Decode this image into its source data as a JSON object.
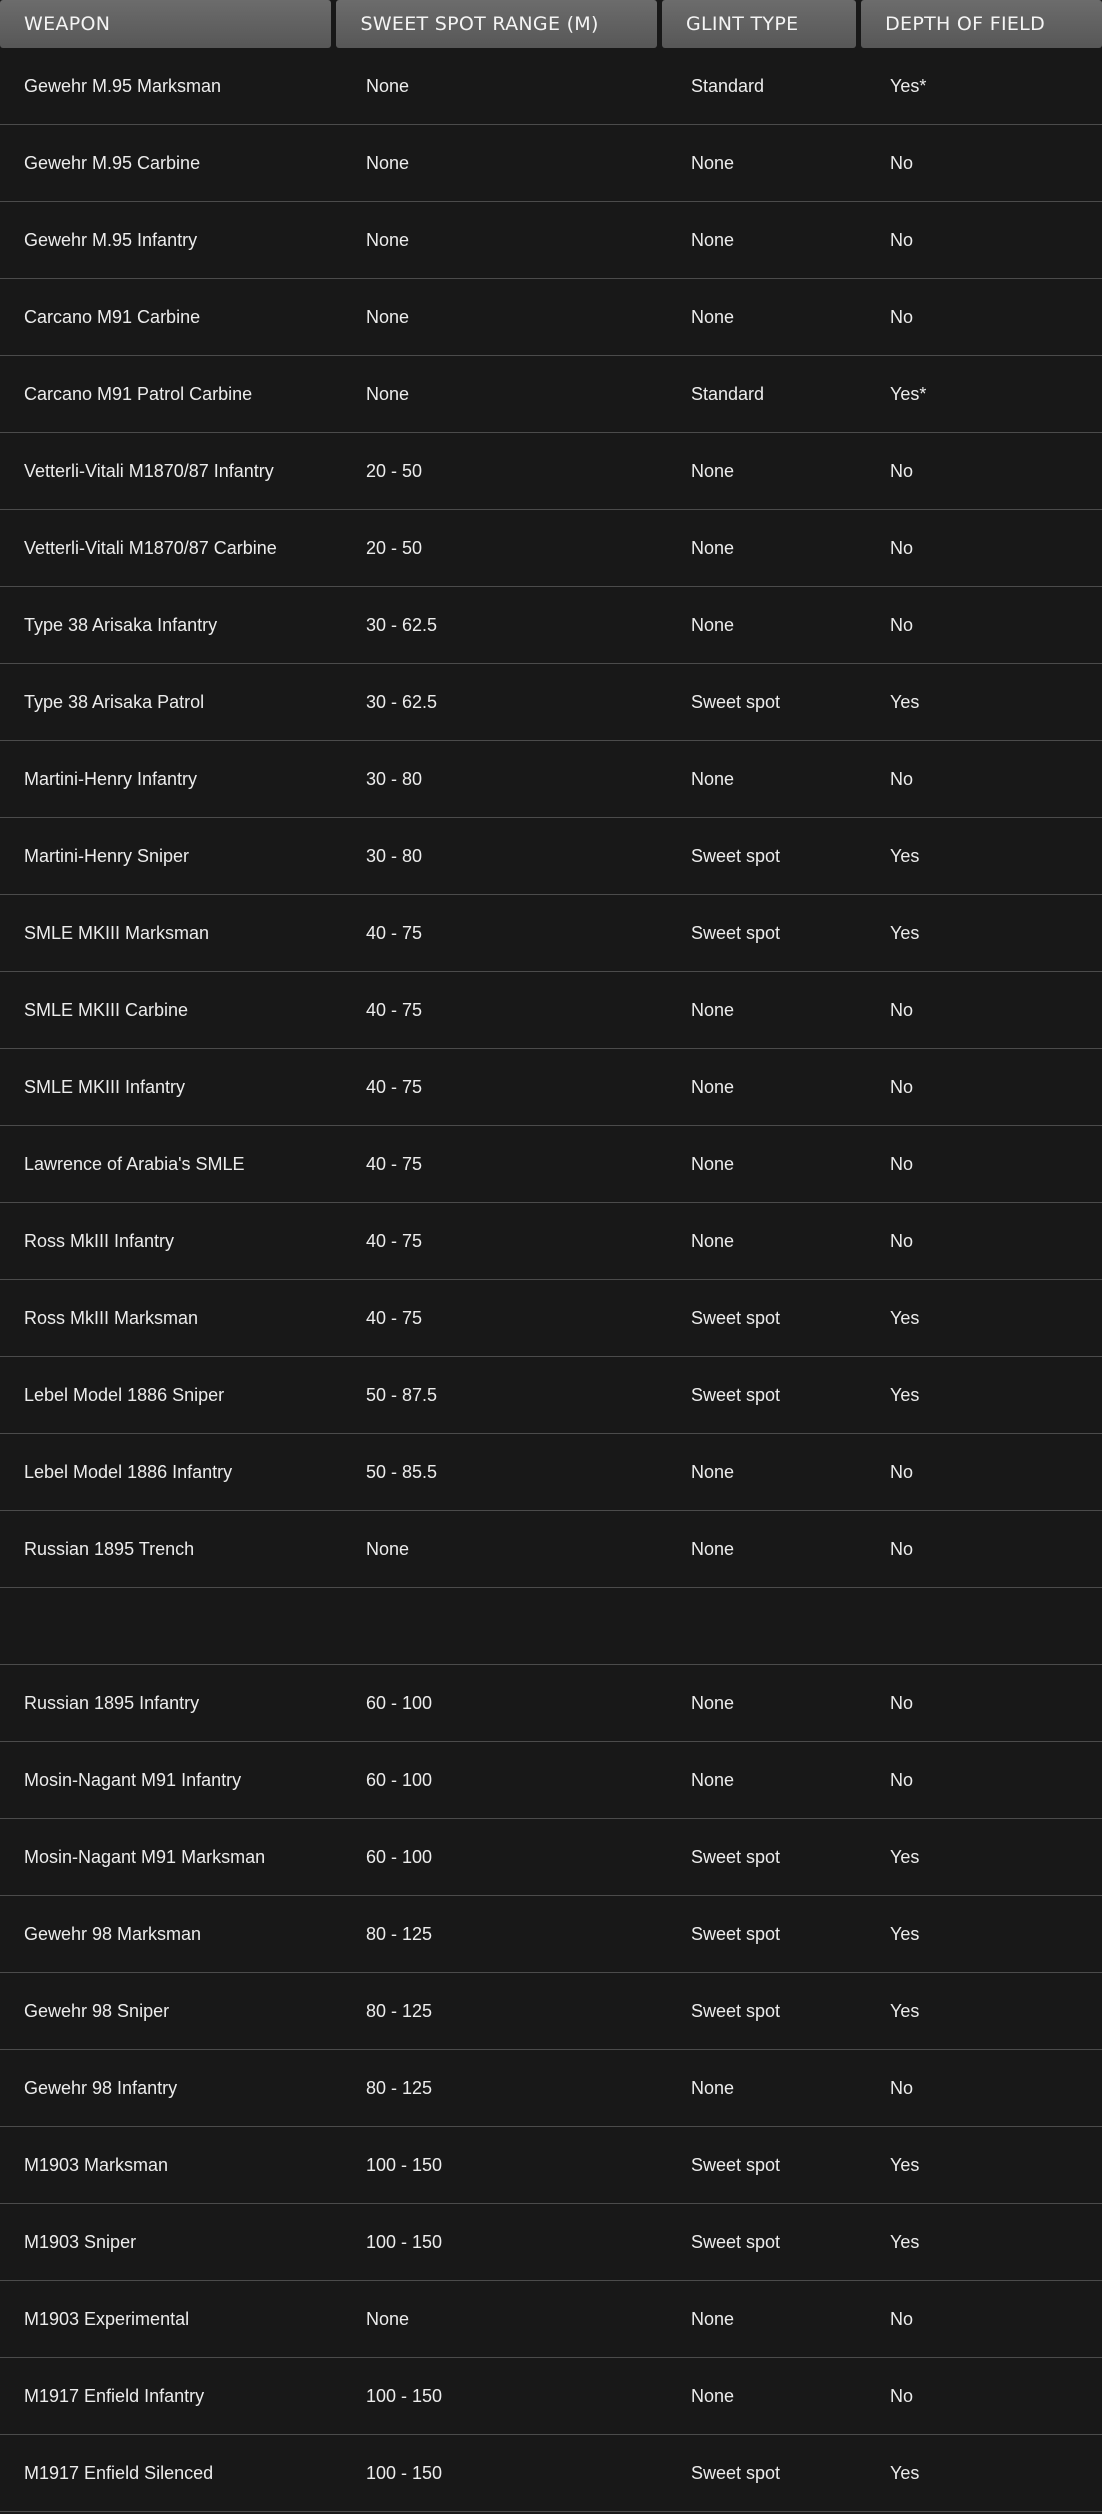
{
  "columns": [
    "WEAPON",
    "SWEET SPOT RANGE (M)",
    "GLINT TYPE",
    "DEPTH OF FIELD"
  ],
  "rows": [
    [
      "Gewehr M.95 Marksman",
      "None",
      "Standard",
      "Yes*"
    ],
    [
      "Gewehr M.95 Carbine",
      "None",
      "None",
      "No"
    ],
    [
      "Gewehr M.95 Infantry",
      "None",
      "None",
      "No"
    ],
    [
      "Carcano M91 Carbine",
      "None",
      "None",
      "No"
    ],
    [
      "Carcano M91 Patrol Carbine",
      "None",
      "Standard",
      "Yes*"
    ],
    [
      "Vetterli-Vitali M1870/87 Infantry",
      "20 - 50",
      "None",
      "No"
    ],
    [
      "Vetterli-Vitali M1870/87 Carbine",
      "20 - 50",
      "None",
      "No"
    ],
    [
      "Type 38 Arisaka Infantry",
      "30 - 62.5",
      "None",
      "No"
    ],
    [
      "Type 38 Arisaka Patrol",
      "30 - 62.5",
      "Sweet spot",
      "Yes"
    ],
    [
      "Martini-Henry Infantry",
      "30 - 80",
      "None",
      "No"
    ],
    [
      "Martini-Henry Sniper",
      "30 - 80",
      "Sweet spot",
      "Yes"
    ],
    [
      "SMLE MKIII Marksman",
      "40 - 75",
      "Sweet spot",
      "Yes"
    ],
    [
      "SMLE MKIII Carbine",
      "40 - 75",
      "None",
      "No"
    ],
    [
      "SMLE MKIII Infantry",
      "40 - 75",
      "None",
      "No"
    ],
    [
      "Lawrence of Arabia's SMLE",
      "40 - 75",
      "None",
      "No"
    ],
    [
      "Ross MkIII Infantry",
      "40 - 75",
      "None",
      "No"
    ],
    [
      "Ross MkIII Marksman",
      "40 - 75",
      "Sweet spot",
      "Yes"
    ],
    [
      "Lebel Model 1886 Sniper",
      "50 - 87.5",
      "Sweet spot",
      "Yes"
    ],
    [
      "Lebel Model 1886 Infantry",
      "50 - 85.5",
      "None",
      "No"
    ],
    [
      "Russian 1895 Trench",
      "None",
      "None",
      "No"
    ],
    [
      "",
      "",
      "",
      ""
    ],
    [
      "Russian 1895 Infantry",
      "60 - 100",
      "None",
      "No"
    ],
    [
      "Mosin-Nagant M91 Infantry",
      "60 - 100",
      "None",
      "No"
    ],
    [
      "Mosin-Nagant M91 Marksman",
      "60 - 100",
      "Sweet spot",
      "Yes"
    ],
    [
      "Gewehr 98 Marksman",
      "80 - 125",
      "Sweet spot",
      "Yes"
    ],
    [
      "Gewehr 98 Sniper",
      "80 - 125",
      "Sweet spot",
      "Yes"
    ],
    [
      "Gewehr 98 Infantry",
      "80 - 125",
      "None",
      "No"
    ],
    [
      "M1903 Marksman",
      "100 - 150",
      "Sweet spot",
      "Yes"
    ],
    [
      "M1903 Sniper",
      "100 - 150",
      "Sweet spot",
      "Yes"
    ],
    [
      "M1903 Experimental",
      "None",
      "None",
      "No"
    ],
    [
      "M1917 Enfield Infantry",
      "100 - 150",
      "None",
      "No"
    ],
    [
      "M1917 Enfield Silenced",
      "100 - 150",
      "Sweet spot",
      "Yes"
    ]
  ]
}
